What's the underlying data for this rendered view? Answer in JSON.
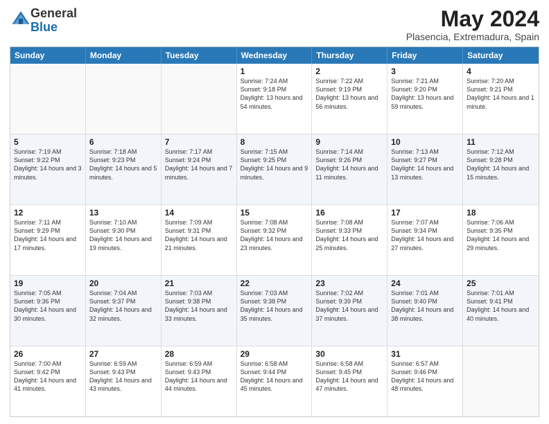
{
  "logo": {
    "general": "General",
    "blue": "Blue"
  },
  "header": {
    "title": "May 2024",
    "subtitle": "Plasencia, Extremadura, Spain"
  },
  "days": [
    "Sunday",
    "Monday",
    "Tuesday",
    "Wednesday",
    "Thursday",
    "Friday",
    "Saturday"
  ],
  "weeks": [
    {
      "alt": false,
      "cells": [
        {
          "day": "",
          "info": ""
        },
        {
          "day": "",
          "info": ""
        },
        {
          "day": "",
          "info": ""
        },
        {
          "day": "1",
          "info": "Sunrise: 7:24 AM\nSunset: 9:18 PM\nDaylight: 13 hours\nand 54 minutes."
        },
        {
          "day": "2",
          "info": "Sunrise: 7:22 AM\nSunset: 9:19 PM\nDaylight: 13 hours\nand 56 minutes."
        },
        {
          "day": "3",
          "info": "Sunrise: 7:21 AM\nSunset: 9:20 PM\nDaylight: 13 hours\nand 59 minutes."
        },
        {
          "day": "4",
          "info": "Sunrise: 7:20 AM\nSunset: 9:21 PM\nDaylight: 14 hours\nand 1 minute."
        }
      ]
    },
    {
      "alt": true,
      "cells": [
        {
          "day": "5",
          "info": "Sunrise: 7:19 AM\nSunset: 9:22 PM\nDaylight: 14 hours\nand 3 minutes."
        },
        {
          "day": "6",
          "info": "Sunrise: 7:18 AM\nSunset: 9:23 PM\nDaylight: 14 hours\nand 5 minutes."
        },
        {
          "day": "7",
          "info": "Sunrise: 7:17 AM\nSunset: 9:24 PM\nDaylight: 14 hours\nand 7 minutes."
        },
        {
          "day": "8",
          "info": "Sunrise: 7:15 AM\nSunset: 9:25 PM\nDaylight: 14 hours\nand 9 minutes."
        },
        {
          "day": "9",
          "info": "Sunrise: 7:14 AM\nSunset: 9:26 PM\nDaylight: 14 hours\nand 11 minutes."
        },
        {
          "day": "10",
          "info": "Sunrise: 7:13 AM\nSunset: 9:27 PM\nDaylight: 14 hours\nand 13 minutes."
        },
        {
          "day": "11",
          "info": "Sunrise: 7:12 AM\nSunset: 9:28 PM\nDaylight: 14 hours\nand 15 minutes."
        }
      ]
    },
    {
      "alt": false,
      "cells": [
        {
          "day": "12",
          "info": "Sunrise: 7:11 AM\nSunset: 9:29 PM\nDaylight: 14 hours\nand 17 minutes."
        },
        {
          "day": "13",
          "info": "Sunrise: 7:10 AM\nSunset: 9:30 PM\nDaylight: 14 hours\nand 19 minutes."
        },
        {
          "day": "14",
          "info": "Sunrise: 7:09 AM\nSunset: 9:31 PM\nDaylight: 14 hours\nand 21 minutes."
        },
        {
          "day": "15",
          "info": "Sunrise: 7:08 AM\nSunset: 9:32 PM\nDaylight: 14 hours\nand 23 minutes."
        },
        {
          "day": "16",
          "info": "Sunrise: 7:08 AM\nSunset: 9:33 PM\nDaylight: 14 hours\nand 25 minutes."
        },
        {
          "day": "17",
          "info": "Sunrise: 7:07 AM\nSunset: 9:34 PM\nDaylight: 14 hours\nand 27 minutes."
        },
        {
          "day": "18",
          "info": "Sunrise: 7:06 AM\nSunset: 9:35 PM\nDaylight: 14 hours\nand 29 minutes."
        }
      ]
    },
    {
      "alt": true,
      "cells": [
        {
          "day": "19",
          "info": "Sunrise: 7:05 AM\nSunset: 9:36 PM\nDaylight: 14 hours\nand 30 minutes."
        },
        {
          "day": "20",
          "info": "Sunrise: 7:04 AM\nSunset: 9:37 PM\nDaylight: 14 hours\nand 32 minutes."
        },
        {
          "day": "21",
          "info": "Sunrise: 7:03 AM\nSunset: 9:38 PM\nDaylight: 14 hours\nand 33 minutes."
        },
        {
          "day": "22",
          "info": "Sunrise: 7:03 AM\nSunset: 9:38 PM\nDaylight: 14 hours\nand 35 minutes."
        },
        {
          "day": "23",
          "info": "Sunrise: 7:02 AM\nSunset: 9:39 PM\nDaylight: 14 hours\nand 37 minutes."
        },
        {
          "day": "24",
          "info": "Sunrise: 7:01 AM\nSunset: 9:40 PM\nDaylight: 14 hours\nand 38 minutes."
        },
        {
          "day": "25",
          "info": "Sunrise: 7:01 AM\nSunset: 9:41 PM\nDaylight: 14 hours\nand 40 minutes."
        }
      ]
    },
    {
      "alt": false,
      "cells": [
        {
          "day": "26",
          "info": "Sunrise: 7:00 AM\nSunset: 9:42 PM\nDaylight: 14 hours\nand 41 minutes."
        },
        {
          "day": "27",
          "info": "Sunrise: 6:59 AM\nSunset: 9:43 PM\nDaylight: 14 hours\nand 43 minutes."
        },
        {
          "day": "28",
          "info": "Sunrise: 6:59 AM\nSunset: 9:43 PM\nDaylight: 14 hours\nand 44 minutes."
        },
        {
          "day": "29",
          "info": "Sunrise: 6:58 AM\nSunset: 9:44 PM\nDaylight: 14 hours\nand 45 minutes."
        },
        {
          "day": "30",
          "info": "Sunrise: 6:58 AM\nSunset: 9:45 PM\nDaylight: 14 hours\nand 47 minutes."
        },
        {
          "day": "31",
          "info": "Sunrise: 6:57 AM\nSunset: 9:46 PM\nDaylight: 14 hours\nand 48 minutes."
        },
        {
          "day": "",
          "info": ""
        }
      ]
    }
  ]
}
